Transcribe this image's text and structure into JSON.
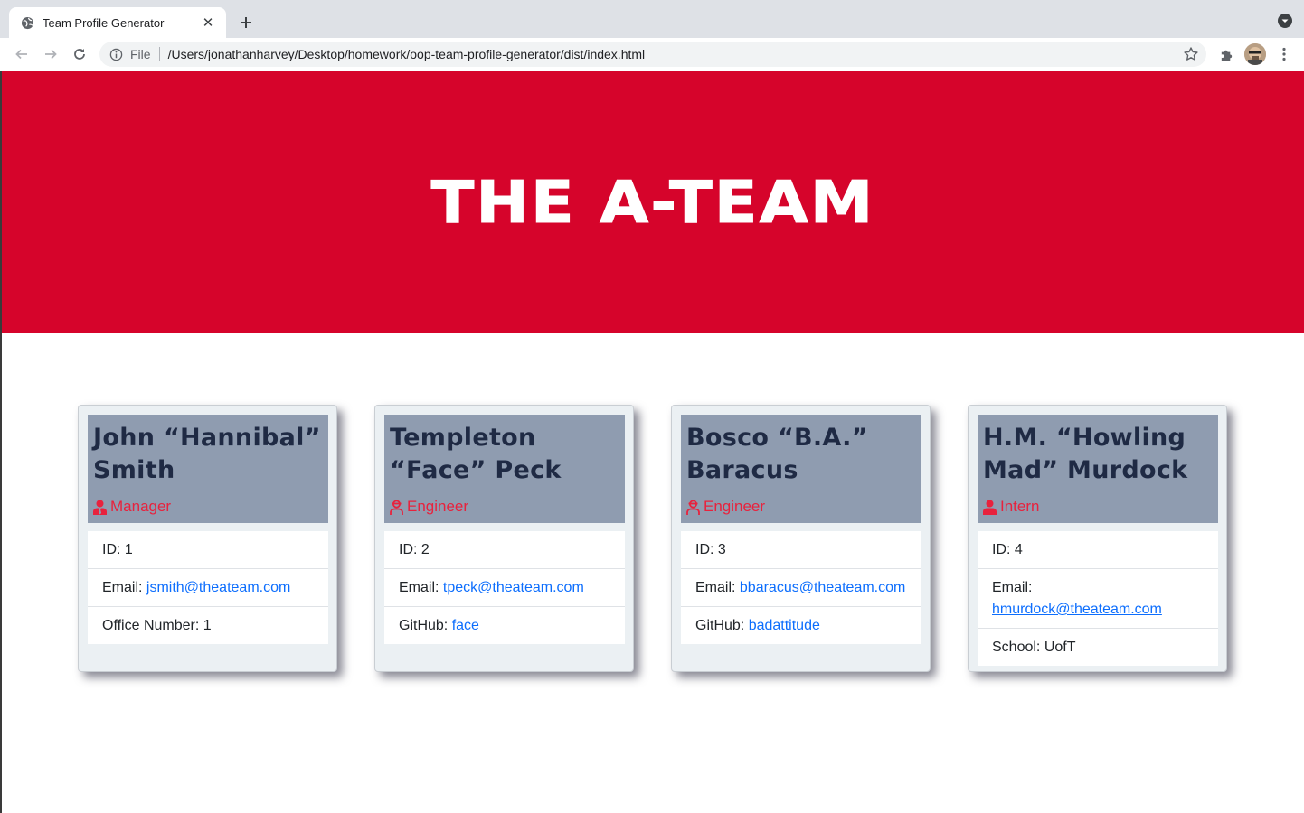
{
  "browser": {
    "tab_title": "Team Profile Generator",
    "scheme_label": "File",
    "url": "/Users/jonathanharvey/Desktop/homework/oop-team-profile-generator/dist/index.html"
  },
  "hero": {
    "title": "THE A-TEAM",
    "color": "#d6042b"
  },
  "cards": [
    {
      "name": "John “Hannibal” Smith",
      "role": "Manager",
      "role_icon": "user-tie-icon",
      "id_label": "ID: 1",
      "email_label": "Email: ",
      "email": "jsmith@theateam.com",
      "extra_label": "Office Number: 1",
      "extra_link": ""
    },
    {
      "name": "Templeton “Face” Peck",
      "role": "Engineer",
      "role_icon": "user-engineer-icon",
      "id_label": "ID: 2",
      "email_label": "Email: ",
      "email": "tpeck@theateam.com",
      "extra_label": "GitHub: ",
      "extra_link": "face"
    },
    {
      "name": "Bosco “B.A.” Baracus",
      "role": "Engineer",
      "role_icon": "user-engineer-icon",
      "id_label": "ID: 3",
      "email_label": "Email: ",
      "email": "bbaracus@theateam.com",
      "extra_label": "GitHub: ",
      "extra_link": "badattitude"
    },
    {
      "name": "H.M. “Howling Mad” Murdock",
      "role": "Intern",
      "role_icon": "user-icon",
      "id_label": "ID: 4",
      "email_label": "Email:",
      "email": "hmurdock@theateam.com",
      "extra_label": "School: UofT",
      "extra_link": ""
    }
  ]
}
